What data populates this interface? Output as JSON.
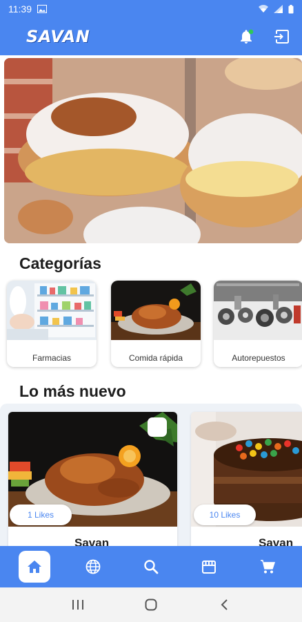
{
  "status_bar": {
    "time": "11:39",
    "icons": [
      "image-icon",
      "wifi-icon",
      "signal-icon",
      "battery-icon"
    ]
  },
  "header": {
    "logo": "SAVAN",
    "actions": [
      "notification-bell-icon",
      "logout-icon"
    ]
  },
  "banner": {
    "image": "donuts-photo"
  },
  "categories": {
    "title": "Categorías",
    "items": [
      {
        "label": "Farmacias",
        "image": "pharmacy-photo"
      },
      {
        "label": "Comida rápida",
        "image": "roast-chicken-photo"
      },
      {
        "label": "Autorepuestos",
        "image": "auto-parts-photo"
      }
    ]
  },
  "newest": {
    "title": "Lo más nuevo",
    "items": [
      {
        "likes": "1 Likes",
        "name": "Savan",
        "image": "roast-chicken-photo"
      },
      {
        "likes": "10 Likes",
        "name": "Savan",
        "image": "chocolate-cake-photo"
      }
    ]
  },
  "bottom_nav": {
    "items": [
      "home-icon",
      "globe-icon",
      "search-icon",
      "store-icon",
      "cart-icon"
    ],
    "active": "home-icon"
  },
  "system_nav": [
    "recents-icon",
    "home-circle-icon",
    "back-icon"
  ],
  "colors": {
    "primary": "#4a86f0",
    "accent": "#2fc85a"
  }
}
